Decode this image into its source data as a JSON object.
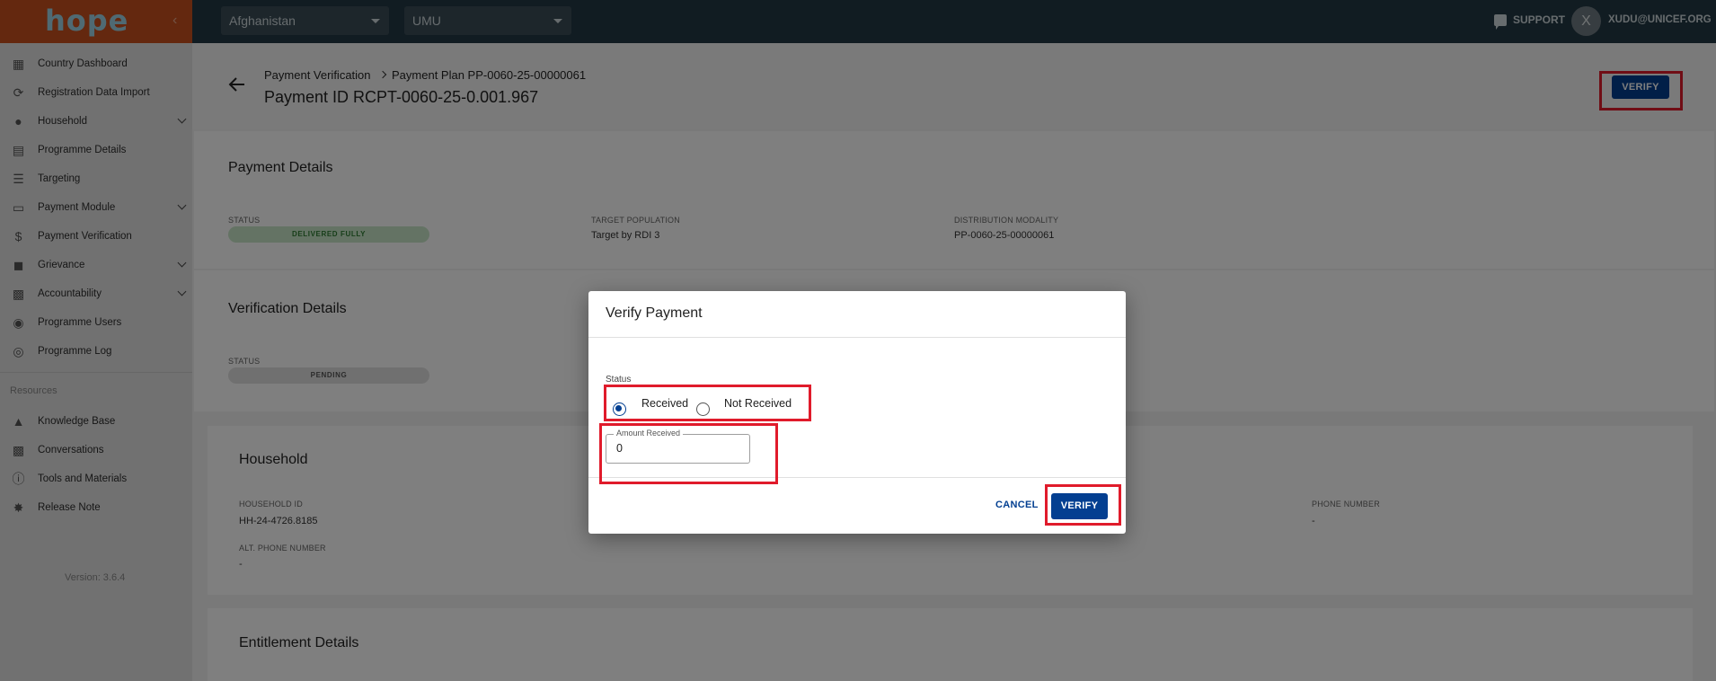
{
  "topbar": {
    "logo": "hope",
    "country_select": "Afghanistan",
    "programme_select": "UMU",
    "support_label": "SUPPORT",
    "avatar_initial": "X",
    "user_email": "XUDU@UNICEF.ORG"
  },
  "sidebar": {
    "items": [
      {
        "label": "Country Dashboard",
        "icon": "dashboard-icon"
      },
      {
        "label": "Registration Data Import",
        "icon": "refresh-icon"
      },
      {
        "label": "Household",
        "icon": "people-icon"
      },
      {
        "label": "Programme Details",
        "icon": "clipboard-icon"
      },
      {
        "label": "Targeting",
        "icon": "list-icon"
      },
      {
        "label": "Payment Module",
        "icon": "credit-card-icon"
      },
      {
        "label": "Payment Verification",
        "icon": "dollar-icon"
      },
      {
        "label": "Grievance",
        "icon": "report-icon"
      },
      {
        "label": "Accountability",
        "icon": "forum-icon"
      },
      {
        "label": "Programme Users",
        "icon": "globe-icon"
      },
      {
        "label": "Programme Log",
        "icon": "track-changes-icon"
      }
    ],
    "resources_label": "Resources",
    "resources": [
      {
        "label": "Knowledge Base",
        "icon": "book-icon"
      },
      {
        "label": "Conversations",
        "icon": "chat-icon"
      },
      {
        "label": "Tools and Materials",
        "icon": "info-icon"
      },
      {
        "label": "Release Note",
        "icon": "badge-icon"
      }
    ],
    "version": "Version: 3.6.4"
  },
  "header": {
    "breadcrumb_1": "Payment Verification",
    "breadcrumb_2": "Payment Plan PP-0060-25-00000061",
    "title": "Payment ID RCPT-0060-25-0.001.967",
    "verify_button": "VERIFY"
  },
  "payment_details": {
    "title": "Payment Details",
    "status_label": "STATUS",
    "status_value": "DELIVERED FULLY",
    "target_population_label": "TARGET POPULATION",
    "target_population_value": "Target by RDI 3",
    "distribution_modality_label": "DISTRIBUTION MODALITY",
    "distribution_modality_value": "PP-0060-25-00000061"
  },
  "verification_details": {
    "title": "Verification Details",
    "status_label": "STATUS",
    "status_value": "PENDING"
  },
  "household": {
    "title": "Household",
    "household_id_label": "HOUSEHOLD ID",
    "household_id_value": "HH-24-4726.8185",
    "phone_label": "PHONE NUMBER",
    "phone_value": "-",
    "alt_phone_label": "ALT. PHONE NUMBER",
    "alt_phone_value": "-"
  },
  "entitlement": {
    "title": "Entitlement Details"
  },
  "dialog": {
    "title": "Verify Payment",
    "status_label": "Status",
    "option_received": "Received",
    "option_not_received": "Not Received",
    "selected_option": "Received",
    "amount_label": "Amount Received",
    "amount_value": "0",
    "cancel_button": "CANCEL",
    "verify_button": "VERIFY"
  },
  "colors": {
    "topbar": "#233944",
    "logo_bg": "#c8511e",
    "primary": "#033f91",
    "highlight": "#e01b2b"
  }
}
